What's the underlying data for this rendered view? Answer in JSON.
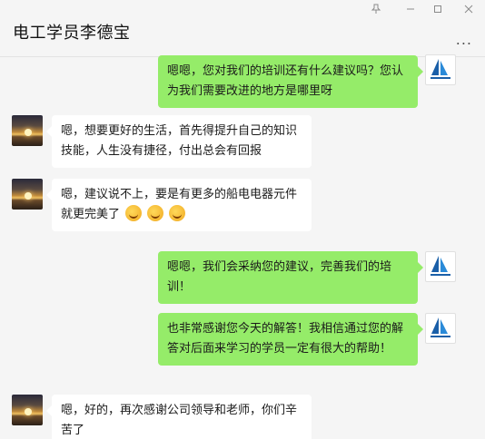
{
  "window": {
    "title": "电工学员李德宝",
    "pin_icon": "pin-icon",
    "minimize_icon": "minimize-icon",
    "maximize_icon": "maximize-icon",
    "close_icon": "close-icon",
    "more_label": "..."
  },
  "messages": [
    {
      "side": "right",
      "text": "嗯嗯，您对我们的培训还有什么建议吗？您认为我们需要改进的地方是哪里呀"
    },
    {
      "side": "left",
      "text": "嗯，想要更好的生活，首先得提升自己的知识技能，人生没有捷径，付出总会有回报"
    },
    {
      "side": "left",
      "text": "嗯，建议说不上，要是有更多的船电电器元件就更完美了",
      "emojis": [
        "grin-emoji",
        "grin-emoji",
        "grin-emoji"
      ]
    },
    {
      "side": "right",
      "text": "嗯嗯，我们会采纳您的建议，完善我们的培训！"
    },
    {
      "side": "right",
      "text": "也非常感谢您今天的解答！我相信通过您的解答对后面来学习的学员一定有很大的帮助！"
    },
    {
      "side": "left",
      "text": "嗯，好的，再次感谢公司领导和老师，你们辛苦了"
    }
  ],
  "colors": {
    "self_bubble": "#95ec69",
    "other_bubble": "#ffffff",
    "background": "#f5f5f5"
  }
}
